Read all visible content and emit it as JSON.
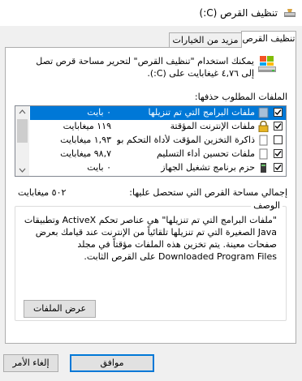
{
  "window": {
    "title": "تنظيف القرص (C:)"
  },
  "tabs": [
    {
      "label": "تنظيف القرص",
      "active": true
    },
    {
      "label": "مزيد من الخيارات",
      "active": false
    }
  ],
  "intro": {
    "text": "يمكنك استخدام \"تنظيف القرص\" لتحرير مساحة قرص تصل إلى ٤,٧٦ غيغابايت على (C:)."
  },
  "files_label": "الملفات المطلوب حذفها:",
  "files": [
    {
      "name": "ملفات البرامج التي تم تنزيلها",
      "size": "٠ بايت",
      "checked": true,
      "selected": true,
      "icon": "folder-icon"
    },
    {
      "name": "ملفات الإنترنت المؤقتة",
      "size": "١١٩ ميغابايت",
      "checked": true,
      "selected": false,
      "icon": "lock-icon"
    },
    {
      "name": "ذاكرة التخزين المؤقت لأداة التحكم بوحدة...",
      "size": "١,٩٣ ميغابايت",
      "checked": false,
      "selected": false,
      "icon": "document-icon"
    },
    {
      "name": "ملفات تحسين أداء التسليم",
      "size": "٩٨,٧ ميغابايت",
      "checked": true,
      "selected": false,
      "icon": "document-icon"
    },
    {
      "name": "حزم برنامج تشغيل الجهاز",
      "size": "٠ بايت",
      "checked": true,
      "selected": false,
      "icon": "device-icon"
    }
  ],
  "total": {
    "label": "إجمالي مساحة القرص التي ستحصل عليها:",
    "value": "٥٠٢ ميغابايت"
  },
  "description": {
    "title": "الوصف",
    "text": "\"ملفات البرامج التي تم تنزيلها\" هي عناصر تحكم ActiveX وتطبيقات Java الصغيرة التي تم تنزيلها تلقائياً من الإنترنت عند قيامك بعرض صفحات معينة. يتم تخزين هذه الملفات مؤقتاً في مجلد Downloaded Program Files على القرص الثابت."
  },
  "buttons": {
    "view_files": "عرض الملفات",
    "ok": "موافق",
    "cancel": "إلغاء الأمر"
  },
  "colors": {
    "selection": "#0078d7",
    "default_button_border": "#0078d7"
  }
}
